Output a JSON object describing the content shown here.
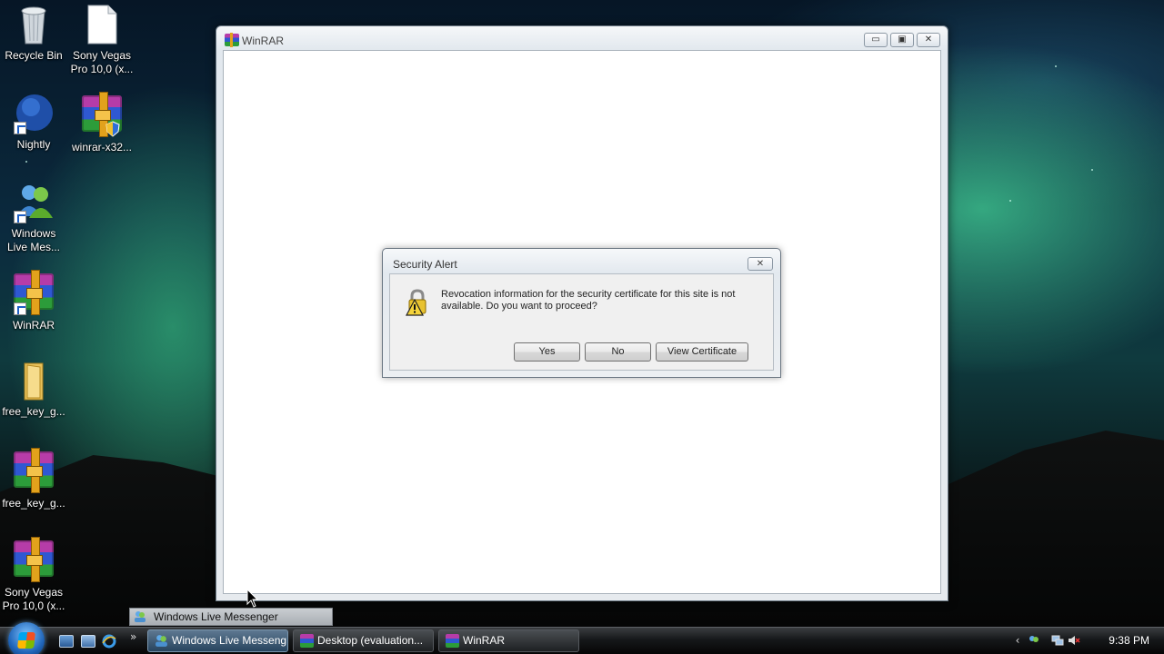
{
  "desktop": {
    "icons": [
      {
        "label": "Recycle Bin",
        "icon": "recycle-bin-icon"
      },
      {
        "label": "Sony Vegas Pro 10,0 (x...",
        "icon": "document-icon"
      },
      {
        "label": "Nightly",
        "icon": "nightly-globe-icon"
      },
      {
        "label": "winrar-x32...",
        "icon": "winrar-installer-icon"
      },
      {
        "label": "Windows Live Mes...",
        "icon": "windows-live-messenger-icon"
      },
      {
        "label": "WinRAR",
        "icon": "winrar-icon"
      },
      {
        "label": "free_key_g...",
        "icon": "folder-icon"
      },
      {
        "label": "free_key_g...",
        "icon": "winrar-archive-icon"
      },
      {
        "label": "Sony Vegas Pro 10,0 (x...",
        "icon": "winrar-archive-icon"
      }
    ]
  },
  "window": {
    "title": "WinRAR",
    "minimize": "▭",
    "maximize": "▣",
    "close": "✕"
  },
  "dialog": {
    "title": "Security Alert",
    "message": "Revocation information for the security certificate for this site is not available. Do you want to proceed?",
    "close": "✕",
    "buttons": {
      "yes": "Yes",
      "no": "No",
      "view_certificate": "View Certificate"
    }
  },
  "tooltip": {
    "text": "Windows Live Messenger"
  },
  "taskbar": {
    "overflow": "»",
    "buttons": [
      {
        "label": "Windows Live Messeng",
        "active": true
      },
      {
        "label": "Desktop (evaluation...",
        "active": false
      },
      {
        "label": "WinRAR",
        "active": false
      }
    ],
    "tray_chevron": "‹",
    "clock": "9:38 PM"
  },
  "colors": {
    "taskbar_active": "#27445e",
    "dialog_body": "#f0f0f0",
    "warning_yellow": "#f5d33a"
  }
}
